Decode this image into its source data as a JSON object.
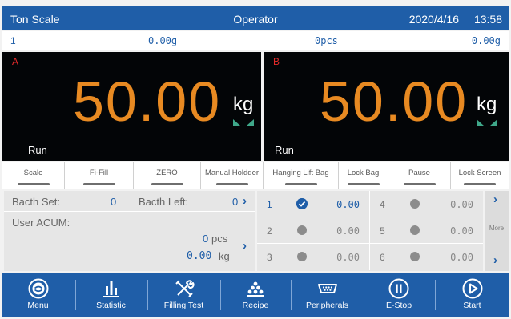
{
  "header": {
    "app_name": "Ton Scale",
    "role": "Operator",
    "date": "2020/4/16",
    "time": "13:58"
  },
  "info_bar": {
    "id": "1",
    "value1": "0.00g",
    "value2": "0pcs",
    "value3": "0.00g"
  },
  "scales": [
    {
      "channel": "A",
      "weight": "50.00",
      "unit": "kg",
      "status": "Run"
    },
    {
      "channel": "B",
      "weight": "50.00",
      "unit": "kg",
      "status": "Run"
    }
  ],
  "functions": [
    "Scale",
    "Fi-Fill",
    "ZERO",
    "Manual Holdder",
    "Hanging Lift Bag",
    "Lock Bag",
    "Pause",
    "Lock Screen"
  ],
  "batch": {
    "set_label": "Bacth Set:",
    "set_value": "0",
    "left_label": "Bacth Left:",
    "left_value": "0",
    "acum_label": "User ACUM:",
    "pcs_value": "0",
    "pcs_unit": "pcs",
    "kg_value": "0.00",
    "kg_unit": "kg"
  },
  "channels": [
    {
      "no": "1",
      "value": "0.00",
      "selected": true
    },
    {
      "no": "4",
      "value": "0.00",
      "selected": false
    },
    {
      "no": "2",
      "value": "0.00",
      "selected": false
    },
    {
      "no": "5",
      "value": "0.00",
      "selected": false
    },
    {
      "no": "3",
      "value": "0.00",
      "selected": false
    },
    {
      "no": "6",
      "value": "0.00",
      "selected": false
    }
  ],
  "more_label": "More",
  "nav": [
    "Menu",
    "Statistic",
    "Filling Test",
    "Recipe",
    "Peripherals",
    "E-Stop",
    "Start"
  ],
  "colors": {
    "primary": "#1f5ea8",
    "weight": "#e88a22",
    "channel_letter": "#e32a2a",
    "stable_indicator": "#3fa88a"
  }
}
